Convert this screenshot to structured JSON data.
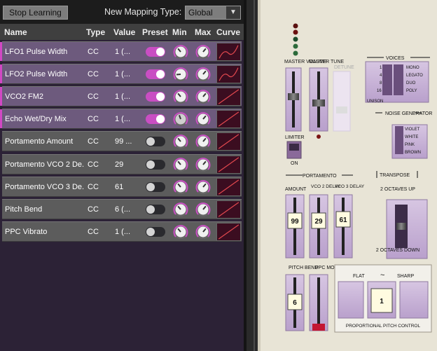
{
  "toolbar": {
    "stop_learning": "Stop Learning",
    "mapping_type_label": "New Mapping Type:",
    "mapping_type_value": "Global"
  },
  "table": {
    "headers": [
      "Name",
      "Type",
      "Value",
      "Preset",
      "Min",
      "Max",
      "Curve"
    ],
    "rows": [
      {
        "name": "LFO1 Pulse Width",
        "type": "CC",
        "value": "1 (...",
        "preset": true,
        "selected": true
      },
      {
        "name": "LFO2 Pulse Width",
        "type": "CC",
        "value": "1 (...",
        "preset": true,
        "selected": true
      },
      {
        "name": "VCO2 FM2",
        "type": "CC",
        "value": "1 (...",
        "preset": true,
        "selected": true
      },
      {
        "name": "Echo Wet/Dry Mix",
        "type": "CC",
        "value": "1 (...",
        "preset": true,
        "selected": true
      },
      {
        "name": "Portamento Amount",
        "type": "CC",
        "value": "99 ...",
        "preset": false,
        "selected": false
      },
      {
        "name": "Portamento VCO 2 De...",
        "type": "CC",
        "value": "29",
        "preset": false,
        "selected": false
      },
      {
        "name": "Portamento VCO 3 De...",
        "type": "CC",
        "value": "61",
        "preset": false,
        "selected": false
      },
      {
        "name": "Pitch Bend",
        "type": "CC",
        "value": "6 (...",
        "preset": false,
        "selected": false
      },
      {
        "name": "PPC Vibrato",
        "type": "CC",
        "value": "1 (...",
        "preset": false,
        "selected": false
      }
    ]
  },
  "synth": {
    "master_volume": "MASTER VOLUME",
    "master_tune": "MASTER TUNE",
    "detune": "DETUNE",
    "limiter": "LIMITER",
    "limiter_on": "ON",
    "voices": {
      "label": "VOICES",
      "left_options": [
        "1",
        "4",
        "8",
        "16"
      ],
      "unison": "UNISON",
      "right_options": [
        "MONO",
        "LEGATO",
        "DUO",
        "POLY"
      ]
    },
    "noise": {
      "label": "NOISE GENERATOR",
      "options": [
        "VIOLET",
        "WHITE",
        "PINK",
        "BROWN"
      ]
    },
    "portamento": {
      "label": "PORTAMENTO",
      "amount": {
        "label": "AMOUNT",
        "value": "99"
      },
      "vco2": {
        "label": "VCO 2 DELAY",
        "value": "29"
      },
      "vco3": {
        "label": "VCO 3 DELAY",
        "value": "61"
      }
    },
    "transpose": {
      "label": "TRANSPOSE",
      "up": "2 OCTAVES UP",
      "down": "2 OCTAVES DOWN"
    },
    "pitch_bend": {
      "label": "PITCH BEND",
      "value": "6"
    },
    "ppc_mod": "PPC MOD",
    "ppc": {
      "flat": "FLAT",
      "sharp": "SHARP",
      "tilde": "~",
      "value": "1",
      "label": "PROPORTIONAL PITCH CONTROL"
    }
  },
  "colors": {
    "accent": "#d148c4",
    "panel_cream": "#e8e4d6",
    "panel_lavender": "#c8b2d6"
  }
}
